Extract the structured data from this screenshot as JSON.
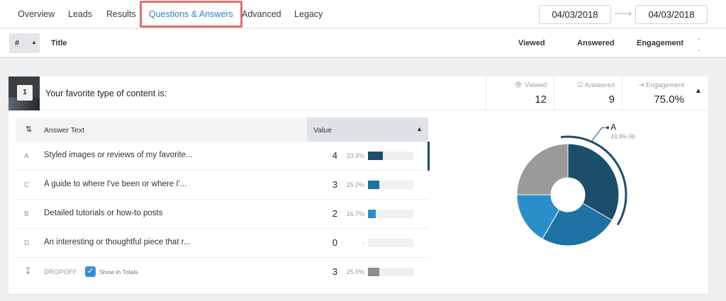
{
  "nav": {
    "tabs": [
      "Overview",
      "Leads",
      "Results",
      "Questions & Answers",
      "Advanced",
      "Legacy"
    ],
    "active_tab": "Questions & Answers",
    "date_from": "04/03/2018",
    "date_to": "04/03/2018"
  },
  "header": {
    "sort_label": "#",
    "title": "Title",
    "viewed": "Viewed",
    "answered": "Answered",
    "engagement": "Engagement"
  },
  "question": {
    "number": "1",
    "title": "Your favorite type of content is:",
    "stats": {
      "viewed_label": "Viewed",
      "viewed": "12",
      "answered_label": "Answered",
      "answered": "9",
      "engagement_label": "Engagement",
      "engagement": "75.0%"
    }
  },
  "table": {
    "answer_text_header": "Answer Text",
    "value_header": "Value",
    "rows": [
      {
        "letter": "A",
        "text": "Styled images or reviews of my favorite...",
        "value": "4",
        "pct": "33.3%",
        "fraction": 0.333,
        "color": "#1c4e6b"
      },
      {
        "letter": "C",
        "text": "A guide to where I've been or where I'...",
        "value": "3",
        "pct": "25.0%",
        "fraction": 0.25,
        "color": "#1e72a3"
      },
      {
        "letter": "B",
        "text": "Detailed tutorials or how-to posts",
        "value": "2",
        "pct": "16.7%",
        "fraction": 0.167,
        "color": "#2a8fc9"
      },
      {
        "letter": "D",
        "text": "An interesting or thoughtful piece that r...",
        "value": "0",
        "pct": "-",
        "fraction": 0,
        "color": "#2a8fc9"
      }
    ],
    "dropoff": {
      "label": "DROPOFF",
      "show_in_totals": "Show in Totals",
      "value": "3",
      "pct": "25.0%",
      "fraction": 0.25,
      "color": "#8e8e8e"
    }
  },
  "chart_data": {
    "type": "pie",
    "categories": [
      "A",
      "C",
      "B",
      "DROPOFF"
    ],
    "values": [
      4,
      3,
      2,
      3
    ],
    "colors": [
      "#1c4e6b",
      "#1e72a3",
      "#2a8fc9",
      "#9a9a9a"
    ],
    "callout": {
      "label": "A",
      "detail": "33.3% (4)"
    }
  }
}
